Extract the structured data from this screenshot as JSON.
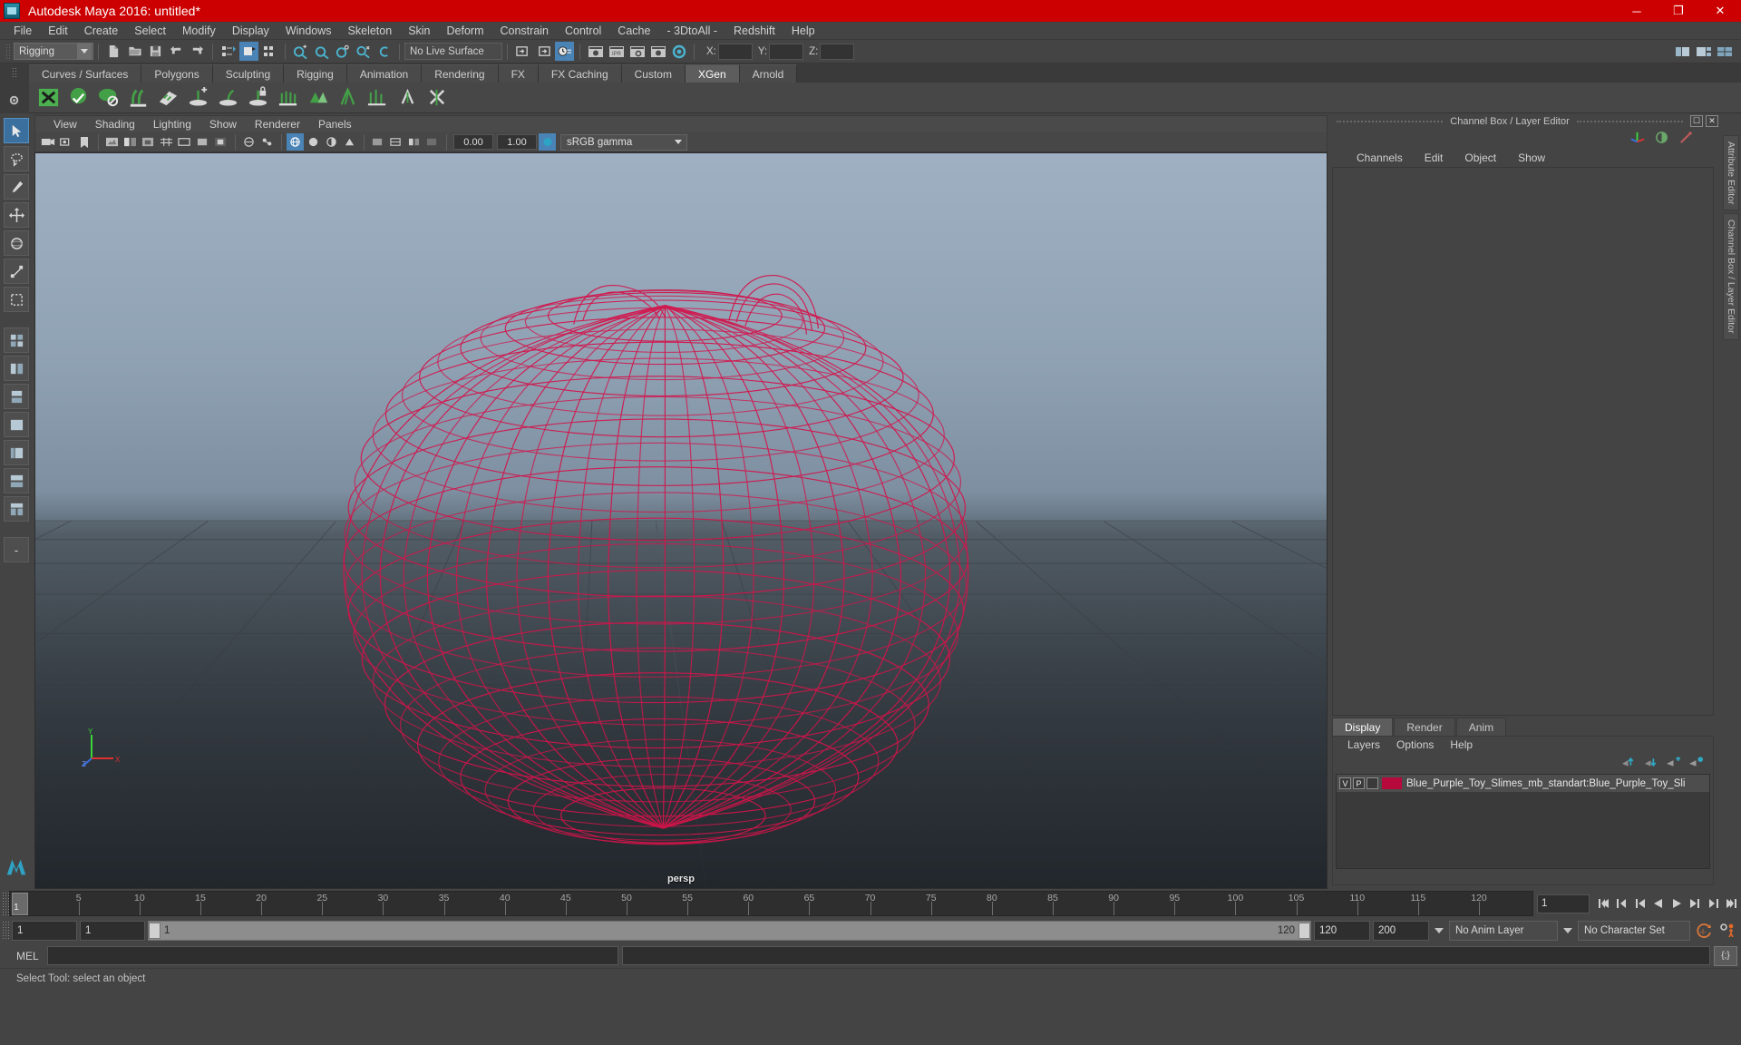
{
  "window": {
    "title": "Autodesk Maya 2016: untitled*",
    "app_icon": "maya-logo-icon",
    "minimize": "─",
    "maximize": "❐",
    "close": "✕"
  },
  "menubar": {
    "items": [
      "File",
      "Edit",
      "Create",
      "Select",
      "Modify",
      "Display",
      "Windows",
      "Skeleton",
      "Skin",
      "Deform",
      "Constrain",
      "Control",
      "Cache",
      "- 3DtoAll -",
      "Redshift",
      "Help"
    ]
  },
  "statusbar": {
    "mode_selector": {
      "value": "Rigging"
    },
    "live_surface": {
      "value": "No Live Surface"
    },
    "coords": {
      "x": {
        "label": "X:",
        "value": ""
      },
      "y": {
        "label": "Y:",
        "value": ""
      },
      "z": {
        "label": "Z:",
        "value": ""
      }
    },
    "icons": [
      "new-scene-icon",
      "open-scene-icon",
      "save-scene-icon",
      "undo-icon",
      "redo-icon",
      "select-by-hierarchy-icon",
      "select-by-object-icon",
      "select-by-component-icon",
      "snap-to-grid-icon",
      "snap-to-curve-icon",
      "snap-to-point-icon",
      "snap-to-projected-icon",
      "snap-to-view-plane-icon",
      "make-live-icon",
      "show-hide-editor-icon",
      "show-hide-attribute-icon",
      "history-icon",
      "render-current-frame-icon",
      "ipr-render-icon",
      "render-settings-icon",
      "hypershade-icon",
      "render-view-icon"
    ],
    "right_icons": [
      "show-manipulator-icon",
      "toggle-panels-icon",
      "full-layout-icon"
    ]
  },
  "shelf": {
    "tabs": [
      "Curves / Surfaces",
      "Polygons",
      "Sculpting",
      "Rigging",
      "Animation",
      "Rendering",
      "FX",
      "FX Caching",
      "Custom",
      "XGen",
      "Arnold"
    ],
    "active_tab": "XGen",
    "icons": [
      "xgen-create-description-icon",
      "xgen-sphere-icon",
      "xgen-dome-icon",
      "xgen-grooming-icon",
      "xgen-guide-place-icon",
      "xgen-add-guide-icon",
      "xgen-sculpt-guide-icon",
      "xgen-lock-guide-icon",
      "xgen-comb-icon",
      "xgen-density-icon",
      "xgen-clump-icon",
      "xgen-noise-icon",
      "xgen-cut-icon",
      "xgen-coil-icon"
    ]
  },
  "toolbox": {
    "tools": [
      "select-tool",
      "lasso-select-tool",
      "paint-select-tool",
      "move-tool",
      "rotate-tool",
      "scale-tool",
      "last-tool-used",
      "four-view-layout",
      "two-pane-side-icon",
      "two-pane-stacked-icon",
      "single-perspective-icon",
      "outliner-persp-layout-icon",
      "hypergraph-persp-layout-icon",
      "persp-graph-layout-icon",
      "maya-logo-icon"
    ],
    "selected": "select-tool",
    "minus_label": "-"
  },
  "viewport": {
    "menu": [
      "View",
      "Shading",
      "Lighting",
      "Show",
      "Renderer",
      "Panels"
    ],
    "toolbar": {
      "gamma_value": "0.00",
      "exposure_value": "1.00",
      "color_management": "sRGB gamma",
      "icons": [
        "select-camera-icon",
        "camera-attributes-icon",
        "bookmark-icon",
        "image-plane-icon",
        "two-sided-lighting-icon",
        "shadows-icon",
        "grid-toggle-icon",
        "film-gate-icon",
        "resolution-gate-icon",
        "gate-mask-icon",
        "xray-icon",
        "xray-joints-icon",
        "wireframe-shading-icon",
        "smooth-shade-all-icon",
        "smooth-shade-selected-icon",
        "flat-shade-icon",
        "bounding-box-icon",
        "textured-icon",
        "use-all-lights-icon",
        "shadows-toggle-icon",
        "ambient-occlusion-icon",
        "motion-blur-icon",
        "multisample-icon",
        "depth-of-field-icon",
        "isolate-select-icon",
        "xray-mode-icon",
        "exposure-icon",
        "gamma-icon",
        "color-management-icon"
      ]
    },
    "camera_label": "persp",
    "object": {
      "name": "Blue_Purple_Toy_Slimes wireframe mesh",
      "wire_color": "#d3144b"
    },
    "axis_gizmo": {
      "y": "Y",
      "x": "X",
      "z": "Z"
    }
  },
  "right_panel": {
    "title": "Channel Box / Layer Editor",
    "win_buttons": [
      "undock-icon",
      "close-icon"
    ],
    "header_icons": [
      "show-manipulators-icon",
      "channel-box-icon",
      "attribute-editor-icon"
    ],
    "channel_menu": [
      "Channels",
      "Edit",
      "Object",
      "Show"
    ],
    "layer_editor": {
      "tabs": [
        "Display",
        "Render",
        "Anim"
      ],
      "active_tab": "Display",
      "menu": [
        "Layers",
        "Options",
        "Help"
      ],
      "toolbar_icons": [
        "move-layer-up-icon",
        "move-layer-down-icon",
        "new-layer-icon",
        "new-layer-from-selected-icon"
      ],
      "layers": [
        {
          "visibility": "V",
          "playback": "P",
          "state": "",
          "color": "#b8093c",
          "name": "Blue_Purple_Toy_Slimes_mb_standart:Blue_Purple_Toy_Sli"
        }
      ]
    },
    "vertical_tabs": [
      "Attribute Editor",
      "Channel Box / Layer Editor"
    ]
  },
  "timeline": {
    "start": 1,
    "end": 120,
    "current_frame": "1",
    "ticks": [
      5,
      10,
      15,
      20,
      25,
      30,
      35,
      40,
      45,
      50,
      55,
      60,
      65,
      70,
      75,
      80,
      85,
      90,
      95,
      100,
      105,
      110,
      115,
      120
    ],
    "current_frame_field": "1",
    "playback_icons": [
      "go-to-start-icon",
      "step-back-key-icon",
      "step-back-frame-icon",
      "play-backwards-icon",
      "play-forwards-icon",
      "step-forward-frame-icon",
      "step-forward-key-icon",
      "go-to-end-icon"
    ]
  },
  "rangeslider": {
    "anim_start": "1",
    "range_start": "1",
    "bar_start_label": "1",
    "bar_end_label": "120",
    "range_end": "120",
    "anim_end": "200",
    "anim_layer": "No Anim Layer",
    "character_set": "No Character Set",
    "auto_key_icon": "auto-keyframe-icon",
    "anim_prefs_icon": "animation-preferences-icon"
  },
  "command_line": {
    "label": "MEL",
    "input_value": "",
    "output_value": "",
    "script_editor_icon": "script-editor-icon"
  },
  "helpline": {
    "text": "Select Tool: select an object"
  }
}
